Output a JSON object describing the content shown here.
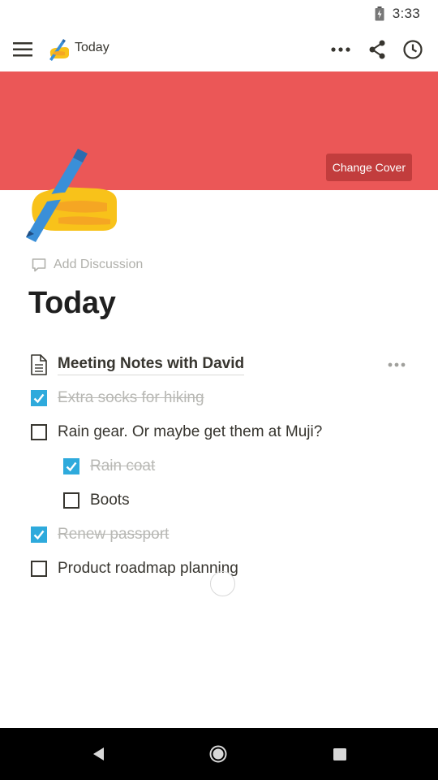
{
  "status_bar": {
    "time": "3:33"
  },
  "topbar": {
    "title": "Today"
  },
  "cover": {
    "color": "#eb5757",
    "change_cover_label": "Change Cover"
  },
  "page": {
    "add_discussion_label": "Add Discussion",
    "title": "Today"
  },
  "blocks": {
    "link_page": {
      "label": "Meeting Notes with David"
    },
    "todos": [
      {
        "label": "Extra socks for hiking",
        "checked": true,
        "indent": 0
      },
      {
        "label": "Rain gear. Or maybe get them at Muji?",
        "checked": false,
        "indent": 0
      },
      {
        "label": "Rain coat",
        "checked": true,
        "indent": 1
      },
      {
        "label": "Boots",
        "checked": false,
        "indent": 1
      },
      {
        "label": "Renew passport",
        "checked": true,
        "indent": 0
      },
      {
        "label": "Product roadmap planning",
        "checked": false,
        "indent": 0
      }
    ]
  },
  "colors": {
    "checkbox_checked": "#2eaadc",
    "text": "#37352f",
    "muted": "#b8b8b4"
  },
  "icons": [
    "battery-icon",
    "menu-icon",
    "writing-hand-icon",
    "more-icon",
    "share-icon",
    "history-icon",
    "comment-icon",
    "document-icon",
    "back-icon",
    "home-icon",
    "recent-apps-icon"
  ]
}
